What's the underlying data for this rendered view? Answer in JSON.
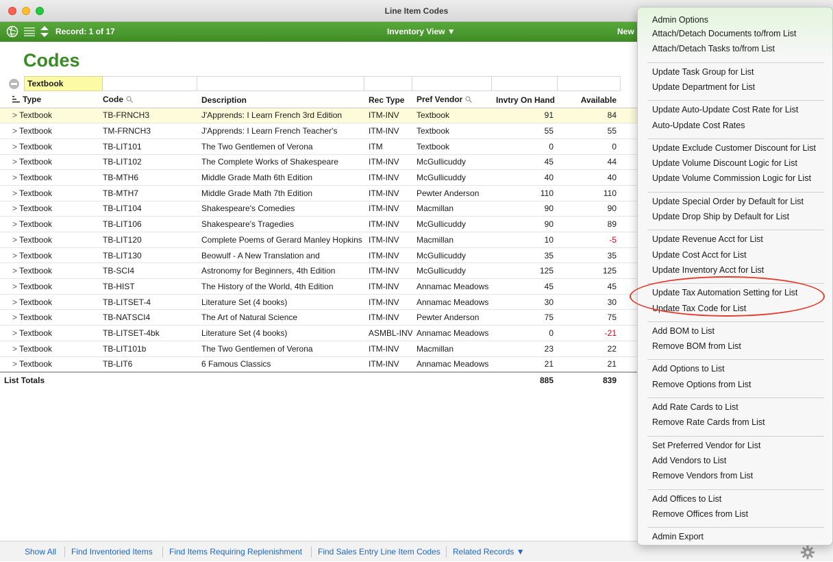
{
  "window": {
    "title": "Line Item Codes"
  },
  "toolbar": {
    "record_label": "Record: 1 of 17",
    "view_selector": "Inventory View ▼",
    "new_label": "New"
  },
  "page_title": "Codes",
  "find": {
    "type_value": "Textbook"
  },
  "table": {
    "columns": [
      "Type",
      "Code",
      "Description",
      "Rec Type",
      "Pref Vendor",
      "Invtry On Hand",
      "Available"
    ],
    "rows": [
      {
        "type": "Textbook",
        "code": "TB-FRNCH3",
        "description": "J'Apprends: I Learn French 3rd Edition",
        "rec_type": "ITM-INV",
        "vendor": "Textbook",
        "on_hand": "91",
        "available": "84"
      },
      {
        "type": "Textbook",
        "code": "TM-FRNCH3",
        "description": "J'Apprends: I Learn French Teacher's",
        "rec_type": "ITM-INV",
        "vendor": "Textbook",
        "on_hand": "55",
        "available": "55"
      },
      {
        "type": "Textbook",
        "code": "TB-LIT101",
        "description": "The Two Gentlemen of Verona",
        "rec_type": "ITM",
        "vendor": "Textbook",
        "on_hand": "0",
        "available": "0"
      },
      {
        "type": "Textbook",
        "code": "TB-LIT102",
        "description": "The Complete Works of Shakespeare",
        "rec_type": "ITM-INV",
        "vendor": "McGullicuddy",
        "on_hand": "45",
        "available": "44"
      },
      {
        "type": "Textbook",
        "code": "TB-MTH6",
        "description": "Middle Grade Math 6th Edition",
        "rec_type": "ITM-INV",
        "vendor": "McGullicuddy",
        "on_hand": "40",
        "available": "40"
      },
      {
        "type": "Textbook",
        "code": "TB-MTH7",
        "description": "Middle Grade Math 7th Edition",
        "rec_type": "ITM-INV",
        "vendor": "Pewter Anderson",
        "on_hand": "110",
        "available": "110"
      },
      {
        "type": "Textbook",
        "code": "TB-LIT104",
        "description": "Shakespeare's Comedies",
        "rec_type": "ITM-INV",
        "vendor": "Macmillan",
        "on_hand": "90",
        "available": "90"
      },
      {
        "type": "Textbook",
        "code": "TB-LIT106",
        "description": "Shakespeare's Tragedies",
        "rec_type": "ITM-INV",
        "vendor": "McGullicuddy",
        "on_hand": "90",
        "available": "89"
      },
      {
        "type": "Textbook",
        "code": "TB-LIT120",
        "description": "Complete Poems of Gerard Manley Hopkins",
        "rec_type": "ITM-INV",
        "vendor": "Macmillan",
        "on_hand": "10",
        "available": "-5"
      },
      {
        "type": "Textbook",
        "code": "TB-LIT130",
        "description": "Beowulf - A New Translation and",
        "rec_type": "ITM-INV",
        "vendor": "McGullicuddy",
        "on_hand": "35",
        "available": "35"
      },
      {
        "type": "Textbook",
        "code": "TB-SCI4",
        "description": "Astronomy for Beginners, 4th Edition",
        "rec_type": "ITM-INV",
        "vendor": "McGullicuddy",
        "on_hand": "125",
        "available": "125"
      },
      {
        "type": "Textbook",
        "code": "TB-HIST",
        "description": "The History of the World, 4th Edition",
        "rec_type": "ITM-INV",
        "vendor": "Annamac Meadows",
        "on_hand": "45",
        "available": "45"
      },
      {
        "type": "Textbook",
        "code": "TB-LITSET-4",
        "description": "Literature Set (4 books)",
        "rec_type": "ITM-INV",
        "vendor": "Annamac Meadows",
        "on_hand": "30",
        "available": "30"
      },
      {
        "type": "Textbook",
        "code": "TB-NATSCI4",
        "description": "The Art of Natural Science",
        "rec_type": "ITM-INV",
        "vendor": "Pewter Anderson",
        "on_hand": "75",
        "available": "75"
      },
      {
        "type": "Textbook",
        "code": "TB-LITSET-4bk",
        "description": "Literature Set (4 books)",
        "rec_type": "ASMBL-INV",
        "vendor": "Annamac Meadows",
        "on_hand": "0",
        "available": "-21"
      },
      {
        "type": "Textbook",
        "code": "TB-LIT101b",
        "description": "The Two Gentlemen of Verona",
        "rec_type": "ITM-INV",
        "vendor": "Macmillan",
        "on_hand": "23",
        "available": "22"
      },
      {
        "type": "Textbook",
        "code": "TB-LIT6",
        "description": "6 Famous Classics",
        "rec_type": "ITM-INV",
        "vendor": "Annamac Meadows",
        "on_hand": "21",
        "available": "21"
      }
    ],
    "totals": {
      "label": "List Totals",
      "on_hand": "885",
      "available": "839"
    }
  },
  "bottom_links": [
    "Show All",
    "Find Inventoried Items",
    "Find Items Requiring Replenishment",
    "Find Sales Entry Line Item Codes",
    "Related Records ▼"
  ],
  "admin_menu": {
    "title": "Admin Options",
    "groups": [
      [
        "Attach/Detach Documents to/from List",
        "Attach/Detach Tasks to/from List"
      ],
      [
        "Update Task Group for List",
        "Update Department for List"
      ],
      [
        "Update Auto-Update Cost Rate for List",
        "Auto-Update Cost Rates"
      ],
      [
        "Update Exclude Customer Discount for List",
        "Update Volume Discount Logic for List",
        "Update Volume Commission Logic for List"
      ],
      [
        "Update Special Order by Default for List",
        "Update Drop Ship by Default for List"
      ],
      [
        "Update Revenue Acct for List",
        "Update Cost Acct for List",
        "Update Inventory Acct for List"
      ],
      [
        "Update Tax Automation Setting for List",
        "Update Tax Code for List"
      ],
      [
        "Add BOM to List",
        "Remove BOM from List"
      ],
      [
        "Add Options to List",
        "Remove Options from List"
      ],
      [
        "Add Rate Cards to List",
        "Remove Rate Cards from List"
      ],
      [
        "Set Preferred Vendor for List",
        "Add Vendors to List",
        "Remove Vendors from List"
      ],
      [
        "Add Offices to List",
        "Remove Offices from List"
      ],
      [
        "Admin Export"
      ]
    ]
  },
  "colors": {
    "toolbar_green": "#4a9a30",
    "title_green": "#3a8a26",
    "link_blue": "#1a66c8",
    "negative_red": "#d0021b",
    "annotation_red": "#e53b2c",
    "find_yellow": "#fdfaa5"
  },
  "icons": [
    "globe-icon",
    "list-icon",
    "record-navigator-icon",
    "search-icon",
    "sort-icon",
    "gear-icon",
    "clear-find-icon",
    "disclosure-chevron-icon"
  ]
}
